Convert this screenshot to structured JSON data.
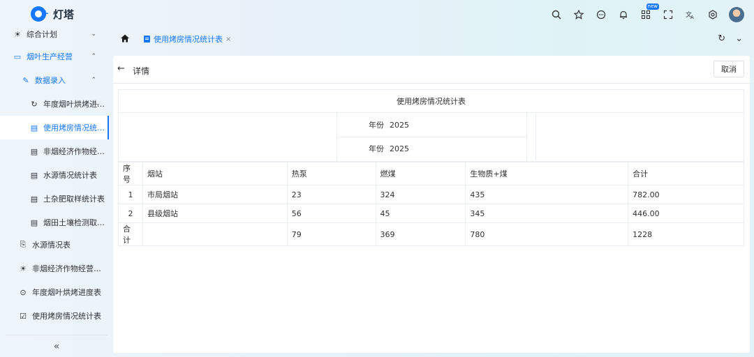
{
  "app": {
    "name": "灯塔",
    "new_badge": "new"
  },
  "top_icons": [
    "search-icon",
    "star-icon",
    "chat-icon",
    "bell-icon",
    "apps-icon",
    "fullscreen-icon",
    "translate-icon",
    "settings-icon"
  ],
  "sidebar": {
    "items": [
      {
        "label": "综合计划",
        "icon": "sun-icon"
      },
      {
        "label": "烟叶生产经营",
        "icon": "folder-icon"
      },
      {
        "label": "数据录入",
        "icon": "edit-icon"
      },
      {
        "label": "年度烟叶烘烤进…",
        "icon": "refresh-icon"
      },
      {
        "label": "使用烤房情况统…",
        "icon": "doc-icon"
      },
      {
        "label": "非烟经济作物经…",
        "icon": "doc-icon"
      },
      {
        "label": "水源情况统计表",
        "icon": "doc-icon"
      },
      {
        "label": "土杂肥取样统计表",
        "icon": "doc-icon"
      },
      {
        "label": "烟田土壤检测取…",
        "icon": "doc-icon"
      },
      {
        "label": "水源情况表",
        "icon": "file-edit-icon"
      },
      {
        "label": "非烟经济作物经营…",
        "icon": "sun-icon"
      },
      {
        "label": "年度烟叶烘烤进度表",
        "icon": "target-icon"
      },
      {
        "label": "使用烤房情况统计表",
        "icon": "checkbox-icon"
      }
    ],
    "collapse": "«"
  },
  "tabs": {
    "active": "使用烤房情况统计表",
    "close": "×"
  },
  "detail": {
    "back": "←",
    "title": "详情",
    "cancel": "取消"
  },
  "report": {
    "title": "使用烤房情况统计表",
    "params": [
      {
        "label": "年份",
        "value": "2025"
      },
      {
        "label": "年份",
        "value": "2025"
      }
    ],
    "columns": [
      "序号",
      "烟站",
      "热泵",
      "燃煤",
      "生物质+煤",
      "合计"
    ],
    "rows": [
      [
        "1",
        "市局烟站",
        "23",
        "324",
        "435",
        "782.00"
      ],
      [
        "2",
        "县级烟站",
        "56",
        "45",
        "345",
        "446.00"
      ],
      [
        "合计",
        "",
        "79",
        "369",
        "780",
        "1228"
      ]
    ]
  }
}
